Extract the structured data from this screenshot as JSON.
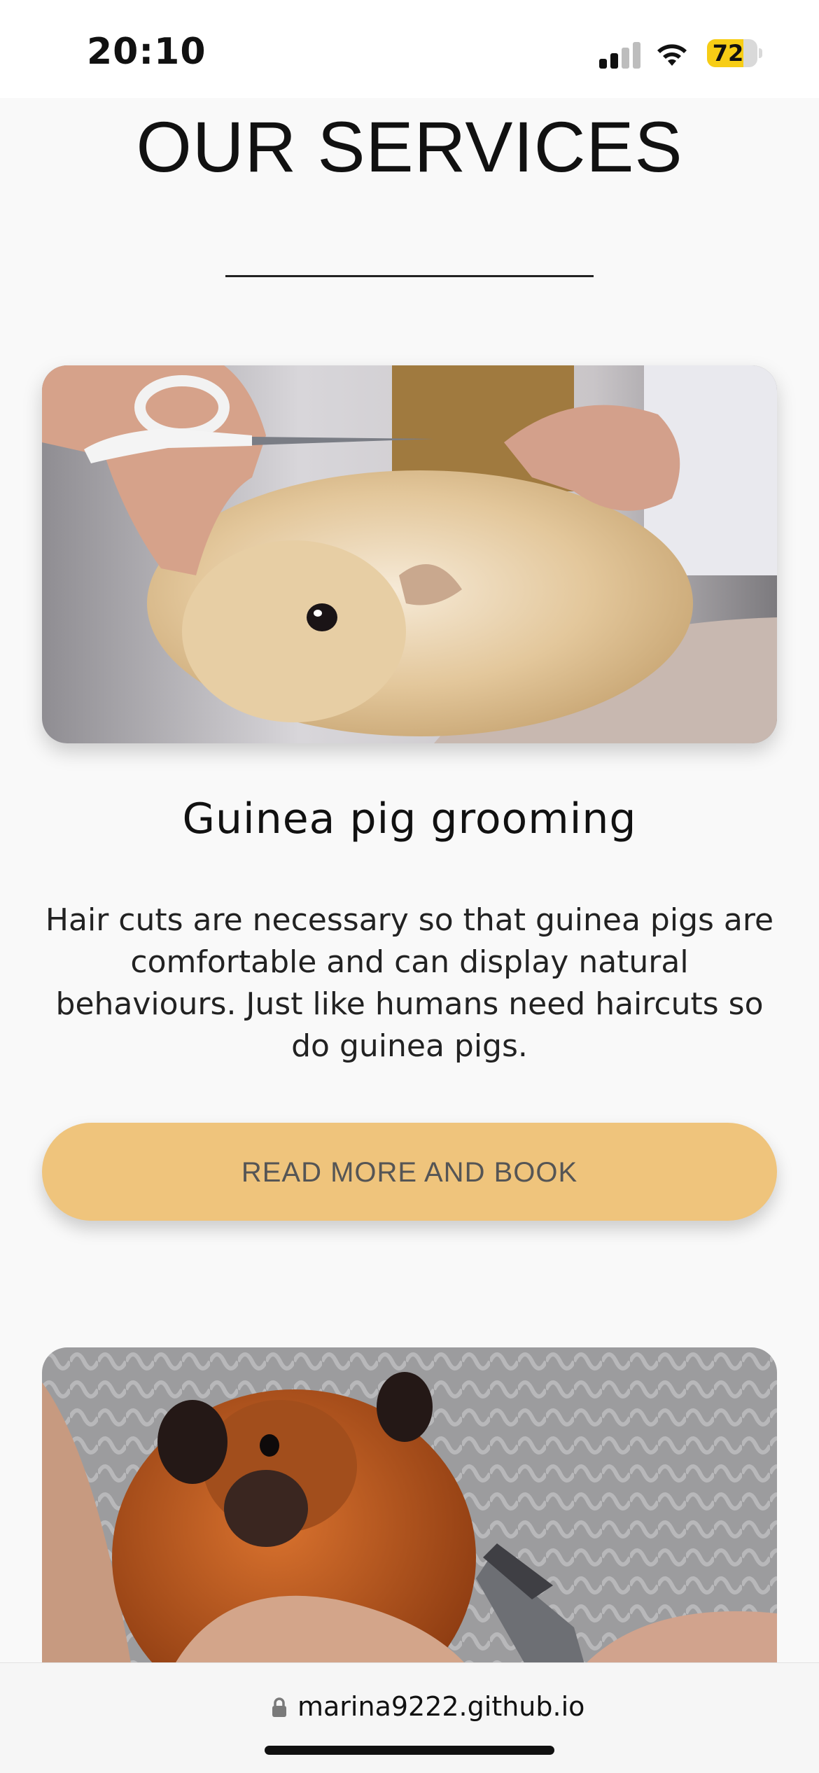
{
  "status_bar": {
    "time": "20:10",
    "battery_level": "72",
    "battery_fraction": 0.72,
    "signal_bars_active": 2,
    "signal_bars_total": 4,
    "icons": [
      "cellular-signal-icon",
      "wifi-icon",
      "battery-icon"
    ]
  },
  "page": {
    "title": "OUR SERVICES"
  },
  "services": [
    {
      "title": "Guinea pig grooming",
      "description": "Hair cuts are necessary so that guinea pigs are comfortable and can display natural behaviours. Just like humans need haircuts so do guinea pigs.",
      "button_label": "READ MORE AND BOOK"
    }
  ],
  "browser": {
    "url": "marina9222.github.io"
  },
  "colors": {
    "background": "#f9f9f9",
    "button": "#efc47c",
    "battery_fill": "#f7cd15"
  }
}
